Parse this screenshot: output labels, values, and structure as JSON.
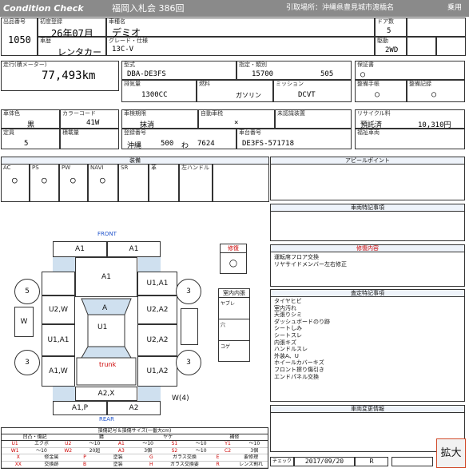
{
  "header": {
    "brand": "Condition Check",
    "auction": "福岡入札会 386回",
    "pickup": "引取場所：沖縄県豊見城市渡橋名",
    "status": "乗用"
  },
  "basic": {
    "lot_label": "出品番号",
    "lot": "1050",
    "first_reg_label": "初度登録",
    "first_reg": "26年07月",
    "vehicle_type_label": "車歴",
    "vehicle_type": "レンタカー",
    "name_label": "車種名",
    "name": "デミオ",
    "grade_label": "グレード・仕様",
    "grade": "13C-V",
    "doors_label": "ドア数",
    "doors": "5",
    "drive_label": "駆動",
    "drive": "2WD"
  },
  "mileage": {
    "label": "走行(積メーター)",
    "value": "77,493km"
  },
  "model": {
    "label": "型式",
    "value": "DBA-DE3FS"
  },
  "designation": {
    "label": "指定・類別",
    "num": "15700",
    "cls": "505"
  },
  "warranty": {
    "label": "保証書",
    "value": "○"
  },
  "maintenance": {
    "label": "整備手帳",
    "value": "○",
    "record_label": "整備記録",
    "record": "○"
  },
  "engine": {
    "disp_label": "排気量",
    "disp": "1300CC",
    "fuel_label": "燃料",
    "fuel": "ガソリン",
    "trans_label": "ミッション",
    "trans": "DCVT"
  },
  "color": {
    "body_label": "車体色",
    "body": "黒",
    "code_label": "カラーコード",
    "code": "41W"
  },
  "capacity": {
    "label": "定員",
    "value": "5",
    "load_label": "積載量",
    "load": ""
  },
  "inspection": {
    "label": "車検期限",
    "value": "抹消",
    "tax_label": "自動車税",
    "tax": "×",
    "unreg_label": "未認識装置",
    "unreg": ""
  },
  "recycle": {
    "label": "リサイクル料",
    "status": "預託済",
    "amount": "10,310円"
  },
  "plate": {
    "reg_label": "登録番号",
    "area": "沖縄",
    "cls": "500",
    "kana": "わ",
    "num": "7624",
    "chassis_label": "車台番号",
    "chassis": "DE3FS-571718"
  },
  "welfare": {
    "label": "福祉車両"
  },
  "equipment": {
    "title": "装備",
    "items": [
      {
        "name": "AC",
        "v": "○"
      },
      {
        "name": "PS",
        "v": "○"
      },
      {
        "name": "PW",
        "v": "○"
      },
      {
        "name": "NAVI",
        "v": "○"
      },
      {
        "name": "SR",
        "v": ""
      },
      {
        "name": "革",
        "v": ""
      },
      {
        "name": "左ハンドル",
        "v": ""
      }
    ]
  },
  "sections": {
    "appeal": "アピールポイント",
    "special": "車両特記事項",
    "repair": "修復内容",
    "repair_text": "運転席フロア交換\nリヤサイドメンバー左右修正",
    "assess": "査定特記事項",
    "assess_text": "タイヤヒビ\n室内汚れ\n天張りシミ\nダッシュボードのり跡\nシートしみ\nシートスレ\n内張キズ\nハンドルスレ\n外装A、U\nホイールカバーキズ\nフロント擦り傷引き\nエンドパネル交換",
    "change": "車両変更情報"
  },
  "diagram": {
    "front": "FRONT",
    "rear": "REAR",
    "trunk": "trunk",
    "repair_label": "修復",
    "repair_mark": "○",
    "interior_label": "室内内張",
    "interior": [
      "ヤブレ",
      "穴",
      "コゲ"
    ],
    "tire_fl": "5",
    "tire_fr": "3",
    "tire_rl": "3",
    "tire_rr": "3",
    "spare": "W",
    "spare_count": "(4)",
    "parts": {
      "a1l": "A1",
      "a1r": "A1",
      "bonnet": "A1",
      "u1a1": "U1,A1",
      "u2w": "U2,W",
      "a": "A",
      "u2a2": "U2,A2",
      "u1": "U1",
      "u1a1b": "U1,A1",
      "u2a2b": "U2,A2",
      "a1w": "A1,W",
      "u1a2": "U1,A2",
      "a2x": "A2,X",
      "a1p": "A1,P",
      "a2b": "A2",
      "w": "W"
    }
  },
  "legend": {
    "title": "損傷記号＆損傷サイズ(一番大cm)",
    "cols": [
      "凹凸・傷記",
      "錆",
      "ヤケ",
      "補修"
    ],
    "rows": [
      [
        "U1",
        "エクボ",
        "U2",
        "〜10",
        "A1",
        "〜10",
        "S1",
        "〜10",
        "Y1",
        "〜10"
      ],
      [
        "W1",
        "〜10",
        "W2",
        "20超",
        "A3",
        "3個",
        "S2",
        "〜10",
        "C2",
        "3個"
      ],
      [
        "X",
        "修金属",
        "P",
        "塗装",
        "G",
        "ガラス交換",
        "E",
        "要修理"
      ],
      [
        "XX",
        "交換跡",
        "B",
        "塗装",
        "H",
        "ガラス交換要す",
        "R",
        "レンズ割れ"
      ]
    ]
  },
  "footer": {
    "check_label": "チェック",
    "check_date": "2017/09/20",
    "check_rank": "R",
    "zoom": "拡大"
  }
}
